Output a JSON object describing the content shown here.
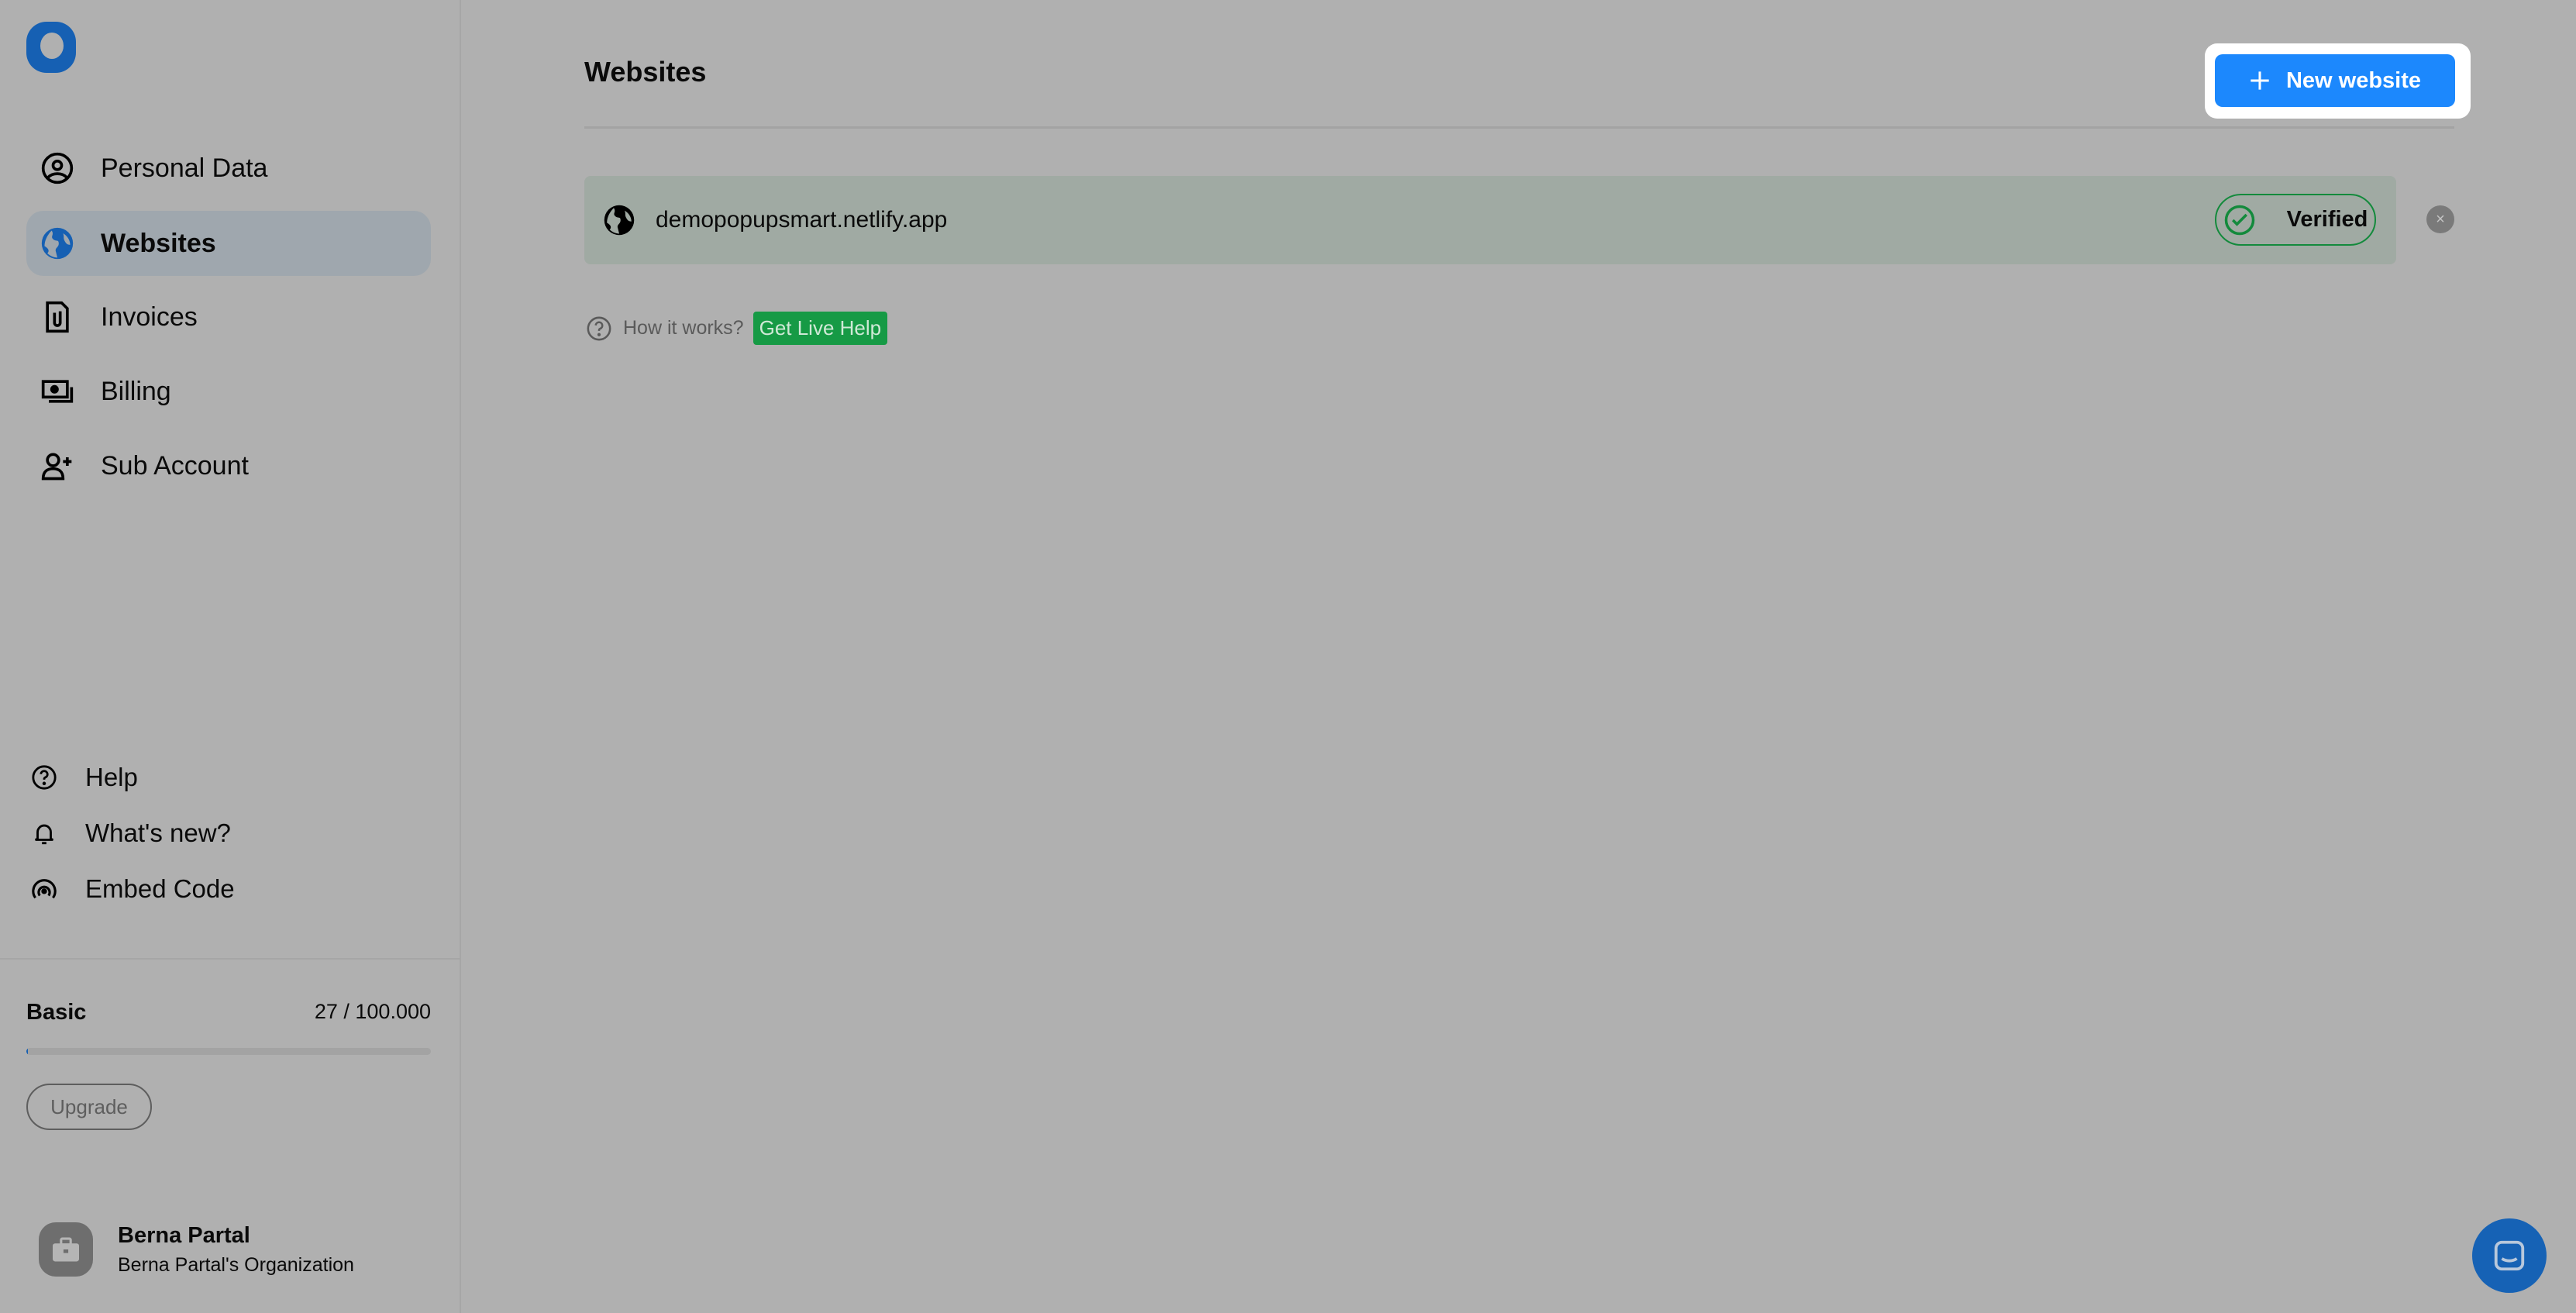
{
  "sidebar": {
    "items": [
      {
        "label": "Personal Data",
        "icon": "user-circle-icon"
      },
      {
        "label": "Websites",
        "icon": "globe-icon",
        "active": true
      },
      {
        "label": "Invoices",
        "icon": "document-clip-icon"
      },
      {
        "label": "Billing",
        "icon": "money-icon"
      },
      {
        "label": "Sub Account",
        "icon": "user-add-icon"
      }
    ],
    "secondary": [
      {
        "label": "Help",
        "icon": "question-circle-icon"
      },
      {
        "label": "What's new?",
        "icon": "bell-icon"
      },
      {
        "label": "Embed Code",
        "icon": "broadcast-icon"
      }
    ],
    "plan": {
      "name": "Basic",
      "usage": "27 / 100.000",
      "usage_fraction": 0.00027,
      "upgrade_label": "Upgrade"
    },
    "user": {
      "name": "Berna Partal",
      "org": "Berna Partal's Organization"
    }
  },
  "main": {
    "title": "Websites",
    "new_button": "New website",
    "websites": [
      {
        "domain": "demopopupsmart.netlify.app",
        "status": "Verified"
      }
    ],
    "help_text": "How it works?",
    "live_help": "Get Live Help"
  },
  "colors": {
    "accent": "#1c88fd",
    "verified": "#138a3c",
    "live_help": "#169a45",
    "brand": "#1660b3"
  }
}
